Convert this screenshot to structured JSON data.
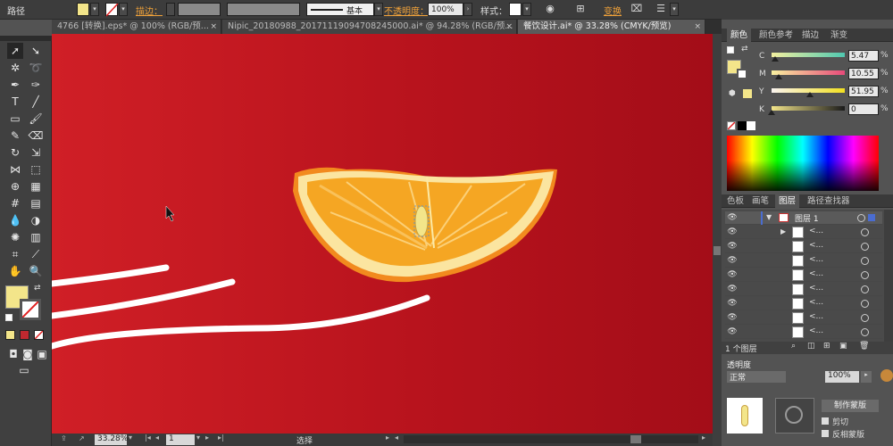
{
  "control_bar": {
    "object_type": "路径",
    "stroke_label": "描边：",
    "stroke_style": "基本",
    "opacity_label": "不透明度：",
    "opacity_value": "100%",
    "style_label": "样式：",
    "transform_label": "变换"
  },
  "tabs": [
    {
      "label": "4766 [转换].eps* @ 100% (RGB/预...",
      "close": "×"
    },
    {
      "label": "Nipic_20180988_20171119094708245000.ai* @ 94.28% (RGB/预...",
      "close": "×"
    },
    {
      "label": "餐饮设计.ai* @ 33.28% (CMYK/预览)",
      "close": "×"
    }
  ],
  "status_bar": {
    "zoom": "33.28%",
    "artboard": "1",
    "tool": "选择"
  },
  "color_panel": {
    "tabs": [
      "颜色",
      "颜色参考",
      "描边",
      "渐变"
    ],
    "sliders": [
      {
        "label": "C",
        "value": "5.47",
        "pct": "%",
        "thumb": 0.05
      },
      {
        "label": "M",
        "value": "10.55",
        "pct": "%",
        "thumb": 0.1
      },
      {
        "label": "Y",
        "value": "51.95",
        "pct": "%",
        "thumb": 0.52
      },
      {
        "label": "K",
        "value": "0",
        "pct": "%",
        "thumb": 0.0
      }
    ],
    "fill_color": "#f3e58a"
  },
  "layers_panel": {
    "tabs": [
      "色板",
      "画笔",
      "图层",
      "路径查找器"
    ],
    "layer_name": "图层 1",
    "sublayer_names": [
      "<...",
      "<...",
      "<...",
      "<...",
      "<...",
      "<...",
      "<...",
      "<..."
    ],
    "footer": "1 个图层"
  },
  "transparency_panel": {
    "title": "透明度",
    "mode": "正常",
    "opacity": "100%",
    "make_mask": "制作蒙版",
    "clip": "剪切",
    "invert_mask": "反相蒙版"
  },
  "colors": {
    "canvas_left": "#d01f26",
    "canvas_right": "#a30d18",
    "orange": "#f5a623",
    "peel": "#fce9a5",
    "accent": "#f0a23a"
  }
}
